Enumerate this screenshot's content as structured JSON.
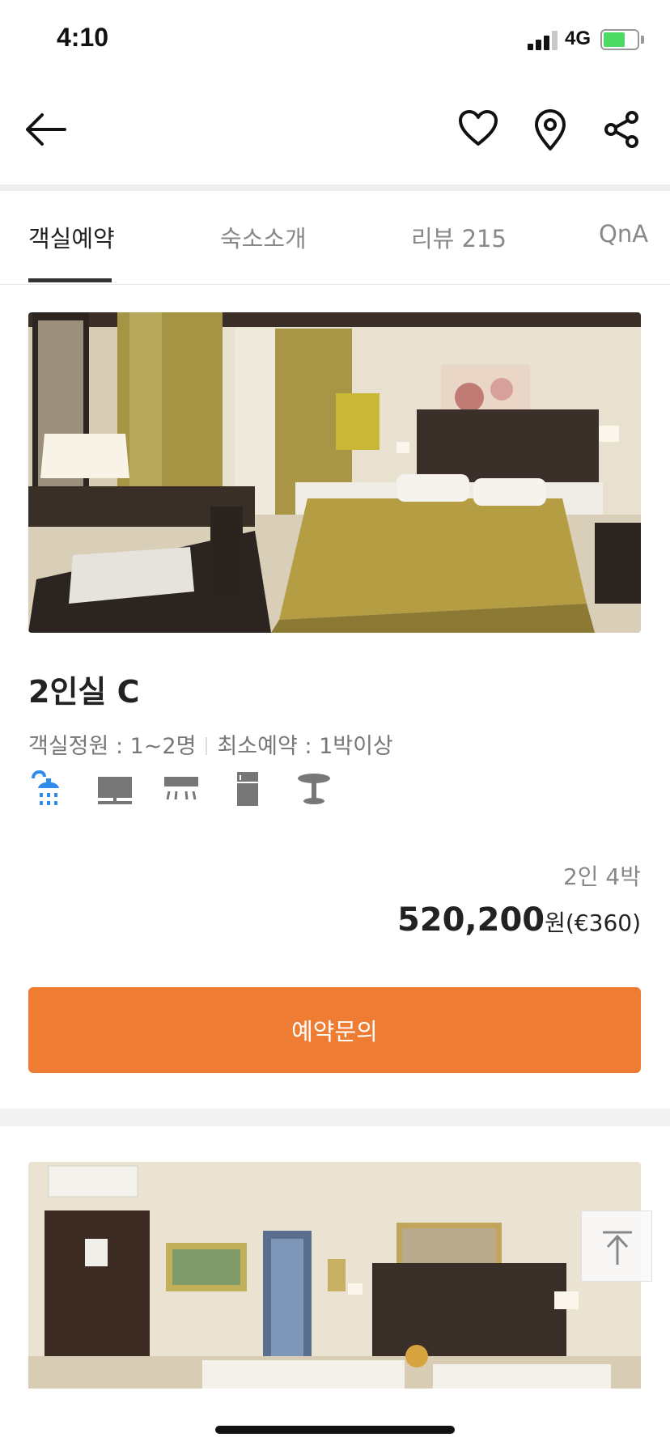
{
  "status_bar": {
    "time": "4:10",
    "network": "4G",
    "battery_color": "#4cd964"
  },
  "header": {
    "back_icon": "arrow-left-icon",
    "actions": [
      "heart-icon",
      "location-pin-icon",
      "share-icon"
    ]
  },
  "tabs": [
    {
      "label": "객실예약",
      "active": true
    },
    {
      "label": "숙소소개",
      "active": false
    },
    {
      "label": "리뷰 215",
      "active": false
    },
    {
      "label": "QnA",
      "active": false
    }
  ],
  "room": {
    "name": "2인실 C",
    "capacity": "객실정원 : 1~2명",
    "min_stay": "최소예약 : 1박이상",
    "amenities": [
      "shower-icon",
      "tv-icon",
      "air-conditioner-icon",
      "refrigerator-icon",
      "table-icon"
    ],
    "highlight_color": "#2e8cf0",
    "nights": "2인 4박",
    "price": "520,200",
    "price_unit": "원(€360)",
    "reserve_label": "예약문의",
    "accent_color": "#ee7c32"
  },
  "floating": {
    "scroll_top_icon": "arrow-up-to-top-icon"
  }
}
